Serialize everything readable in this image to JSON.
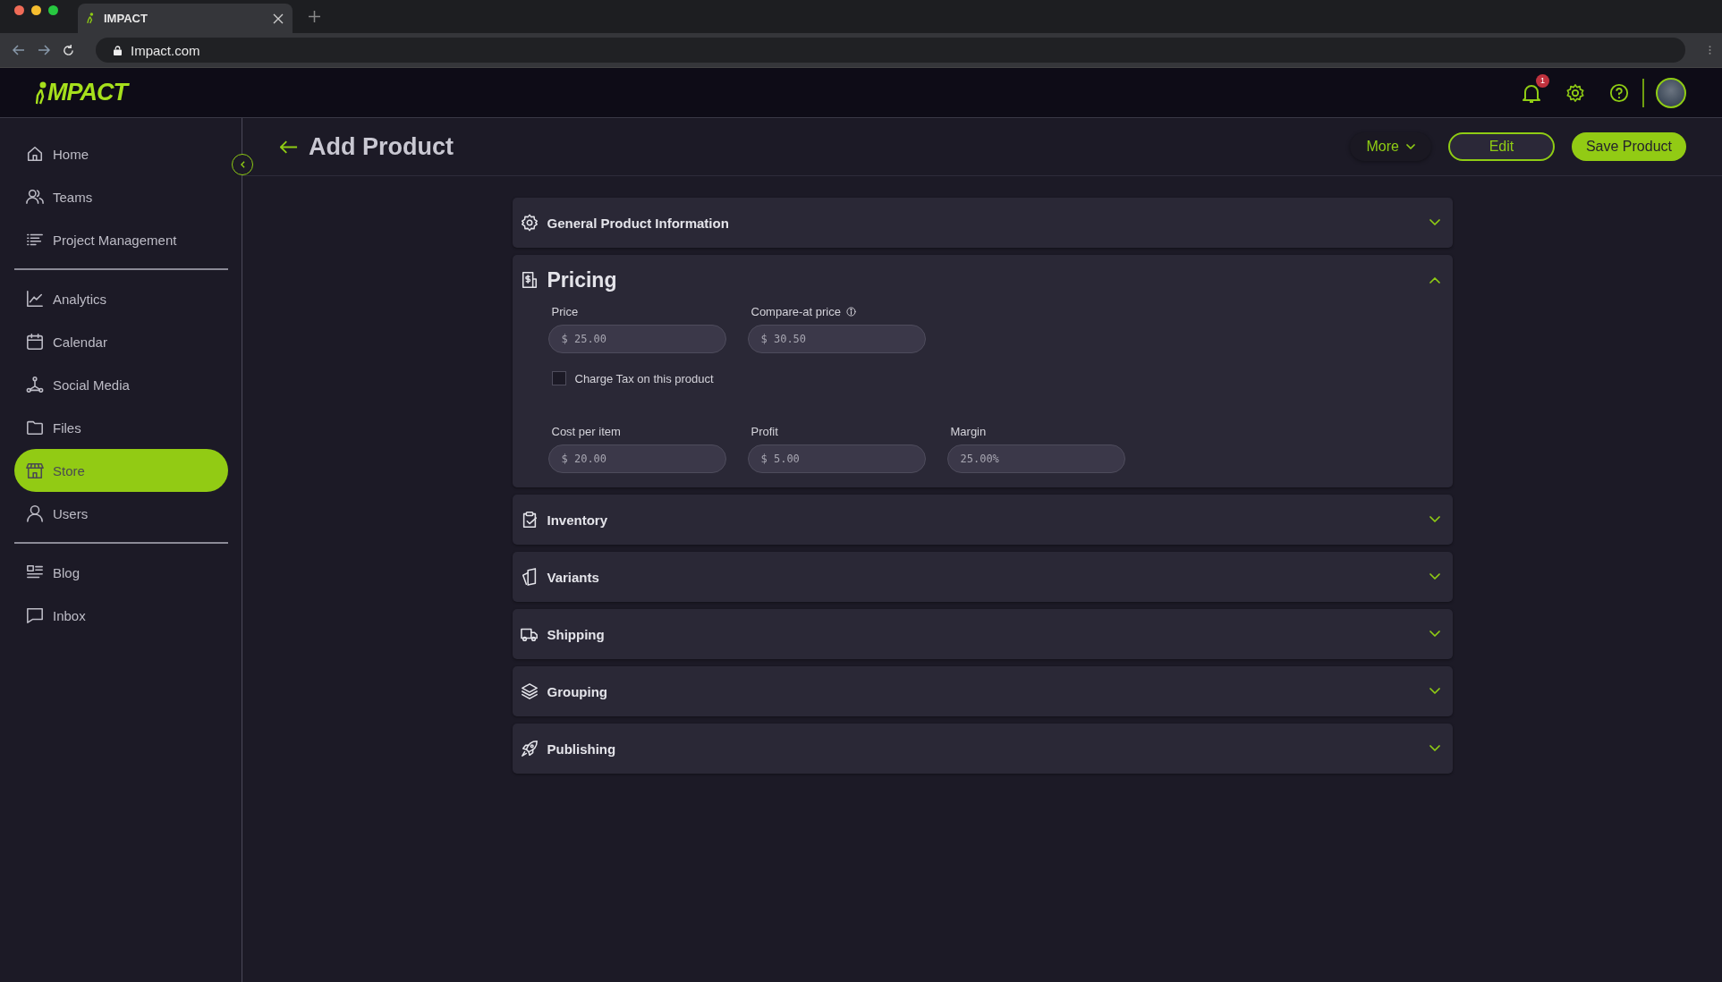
{
  "browser": {
    "tab_title": "IMPACT",
    "url": "Impact.com"
  },
  "app_header": {
    "logo": "MPACT",
    "notification_count": "1"
  },
  "sidebar": {
    "groups": [
      {
        "items": [
          {
            "label": "Home",
            "selected": false
          },
          {
            "label": "Teams",
            "selected": false
          },
          {
            "label": "Project Management",
            "selected": false
          }
        ]
      },
      {
        "items": [
          {
            "label": "Analytics",
            "selected": false
          },
          {
            "label": "Calendar",
            "selected": false
          },
          {
            "label": "Social Media",
            "selected": false
          },
          {
            "label": "Files",
            "selected": false
          },
          {
            "label": "Store",
            "selected": true
          },
          {
            "label": "Users",
            "selected": false
          }
        ]
      },
      {
        "items": [
          {
            "label": "Blog",
            "selected": false
          },
          {
            "label": "Inbox",
            "selected": false
          }
        ]
      }
    ]
  },
  "page": {
    "title": "Add Product",
    "actions": [
      {
        "label": "More",
        "kind": "menu"
      },
      {
        "label": "Edit",
        "kind": "outline"
      },
      {
        "label": "Save Product",
        "kind": "primary"
      }
    ]
  },
  "sections": [
    {
      "title": "General Product Information",
      "expanded": false
    },
    {
      "title": "Pricing",
      "expanded": true,
      "content": [
        {
          "kind": "fields",
          "fields": [
            {
              "label": "Price",
              "value": "$ 25.00",
              "info": false
            },
            {
              "label": "Compare-at price",
              "value": "$ 30.50",
              "info": true
            }
          ]
        },
        {
          "kind": "checkbox",
          "label": "Charge Tax on  this product",
          "checked": false
        },
        {
          "kind": "fields",
          "fields": [
            {
              "label": "Cost per item",
              "value": "$ 20.00",
              "info": false
            },
            {
              "label": "Profit",
              "value": "$ 5.00",
              "info": false
            },
            {
              "label": "Margin",
              "value": "25.00%",
              "info": false
            }
          ]
        }
      ]
    },
    {
      "title": "Inventory",
      "expanded": false
    },
    {
      "title": "Variants",
      "expanded": false
    },
    {
      "title": "Shipping",
      "expanded": false
    },
    {
      "title": "Grouping",
      "expanded": false
    },
    {
      "title": "Publishing",
      "expanded": false
    }
  ]
}
